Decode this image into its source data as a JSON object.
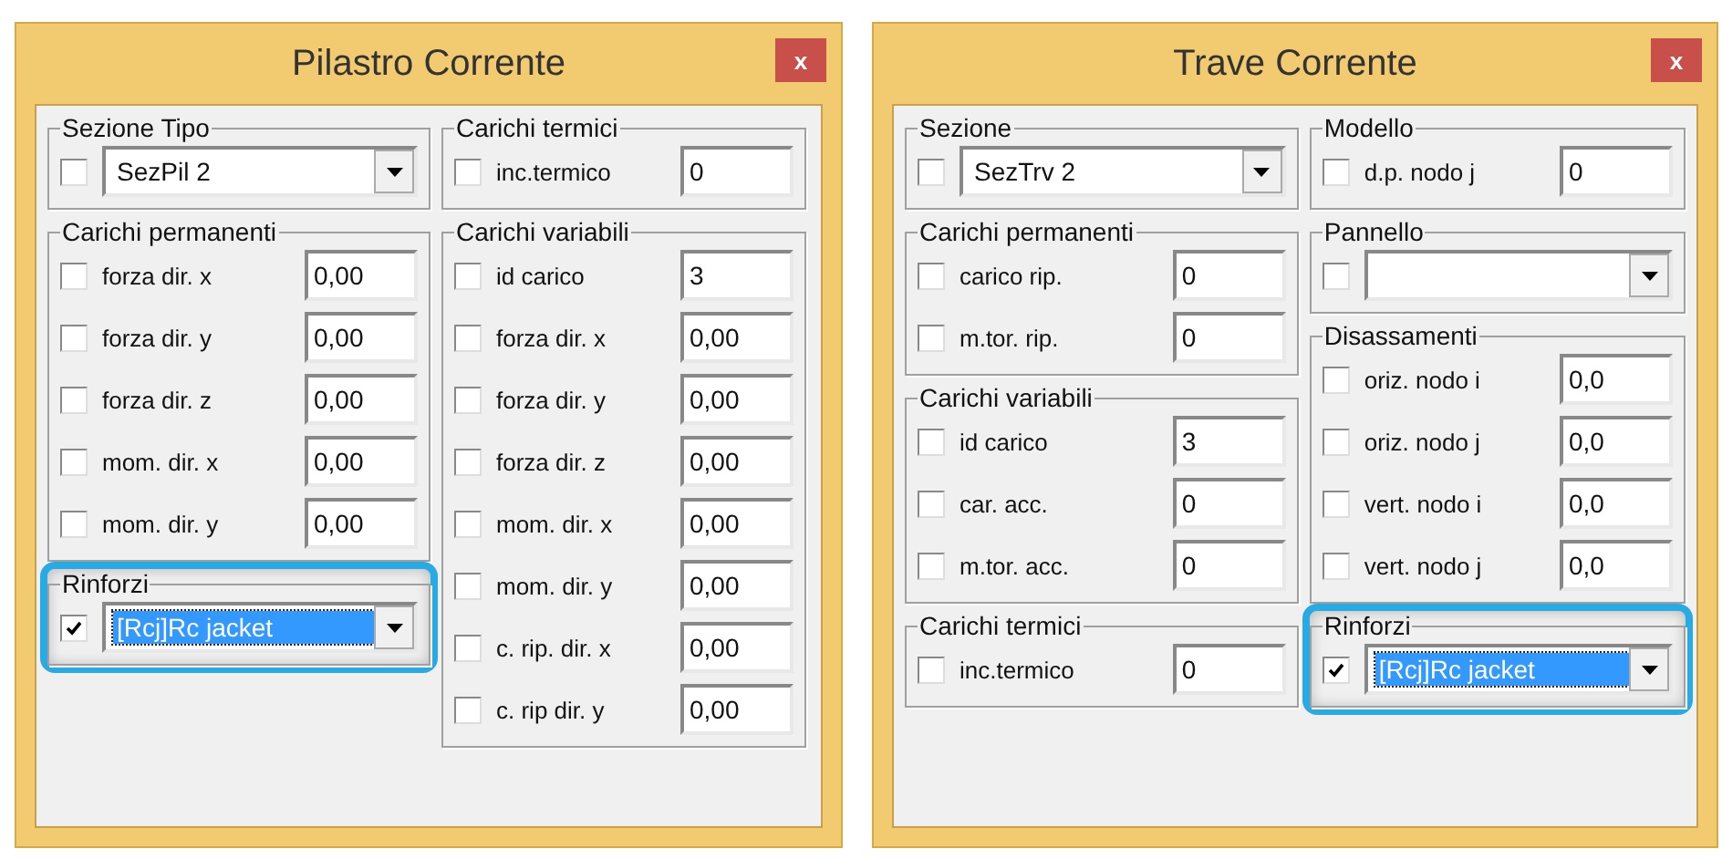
{
  "dialogs": [
    {
      "title": "Pilastro Corrente",
      "close": "x",
      "columns": [
        [
          {
            "legend": "Sezione Tipo",
            "rows": [
              {
                "kind": "combo",
                "checked": false,
                "value": "SezPil 2",
                "selected": false
              }
            ]
          },
          {
            "legend": "Carichi permanenti",
            "rows": [
              {
                "kind": "field",
                "checked": false,
                "label": "forza dir. x",
                "value": "0,00"
              },
              {
                "kind": "field",
                "checked": false,
                "label": "forza dir. y",
                "value": "0,00"
              },
              {
                "kind": "field",
                "checked": false,
                "label": "forza dir. z",
                "value": "0,00"
              },
              {
                "kind": "field",
                "checked": false,
                "label": "mom. dir. x",
                "value": "0,00"
              },
              {
                "kind": "field",
                "checked": false,
                "label": "mom. dir. y",
                "value": "0,00"
              }
            ]
          },
          {
            "legend": "Rinforzi",
            "highlighted": true,
            "rows": [
              {
                "kind": "combo",
                "checked": true,
                "value": "[Rcj]Rc jacket",
                "selected": true
              }
            ]
          }
        ],
        [
          {
            "legend": "Carichi termici",
            "rows": [
              {
                "kind": "field",
                "checked": false,
                "label": "inc.termico",
                "value": "0"
              }
            ]
          },
          {
            "legend": "Carichi variabili",
            "rows": [
              {
                "kind": "field",
                "checked": false,
                "label": "id carico",
                "value": "3"
              },
              {
                "kind": "field",
                "checked": false,
                "label": "forza dir. x",
                "value": "0,00"
              },
              {
                "kind": "field",
                "checked": false,
                "label": "forza dir. y",
                "value": "0,00"
              },
              {
                "kind": "field",
                "checked": false,
                "label": "forza dir. z",
                "value": "0,00"
              },
              {
                "kind": "field",
                "checked": false,
                "label": "mom. dir. x",
                "value": "0,00"
              },
              {
                "kind": "field",
                "checked": false,
                "label": "mom. dir. y",
                "value": "0,00"
              },
              {
                "kind": "field",
                "checked": false,
                "label": "c. rip. dir. x",
                "value": "0,00"
              },
              {
                "kind": "field",
                "checked": false,
                "label": "c. rip dir. y",
                "value": "0,00"
              }
            ]
          }
        ]
      ]
    },
    {
      "title": "Trave Corrente",
      "close": "x",
      "columns": [
        [
          {
            "legend": "Sezione",
            "rows": [
              {
                "kind": "combo",
                "checked": false,
                "value": "SezTrv 2",
                "selected": false
              }
            ]
          },
          {
            "legend": "Carichi permanenti",
            "rows": [
              {
                "kind": "field",
                "checked": false,
                "label": "carico rip.",
                "value": "0"
              },
              {
                "kind": "field",
                "checked": false,
                "label": "m.tor. rip.",
                "value": "0"
              }
            ]
          },
          {
            "legend": "Carichi variabili",
            "rows": [
              {
                "kind": "field",
                "checked": false,
                "label": "id carico",
                "value": "3"
              },
              {
                "kind": "field",
                "checked": false,
                "label": "car. acc.",
                "value": "0"
              },
              {
                "kind": "field",
                "checked": false,
                "label": "m.tor. acc.",
                "value": "0"
              }
            ]
          },
          {
            "legend": "Carichi termici",
            "rows": [
              {
                "kind": "field",
                "checked": false,
                "label": "inc.termico",
                "value": "0"
              }
            ]
          }
        ],
        [
          {
            "legend": "Modello",
            "rows": [
              {
                "kind": "field",
                "checked": false,
                "label": "d.p. nodo j",
                "value": "0"
              }
            ]
          },
          {
            "legend": "Pannello",
            "rows": [
              {
                "kind": "combo",
                "checked": false
              }
            ]
          },
          {
            "legend": "Disassamenti",
            "rows": [
              {
                "kind": "field",
                "checked": false,
                "label": "oriz. nodo i",
                "value": "0,0"
              },
              {
                "kind": "field",
                "checked": false,
                "label": "oriz. nodo j",
                "value": "0,0"
              },
              {
                "kind": "field",
                "checked": false,
                "label": "vert. nodo i",
                "value": "0,0"
              },
              {
                "kind": "field",
                "checked": false,
                "label": "vert. nodo j",
                "value": "0,0"
              }
            ]
          },
          {
            "legend": "Rinforzi",
            "highlighted": true,
            "rows": [
              {
                "kind": "combo",
                "checked": true,
                "value": "[Rcj]Rc jacket",
                "selected": true
              }
            ]
          }
        ]
      ]
    }
  ]
}
